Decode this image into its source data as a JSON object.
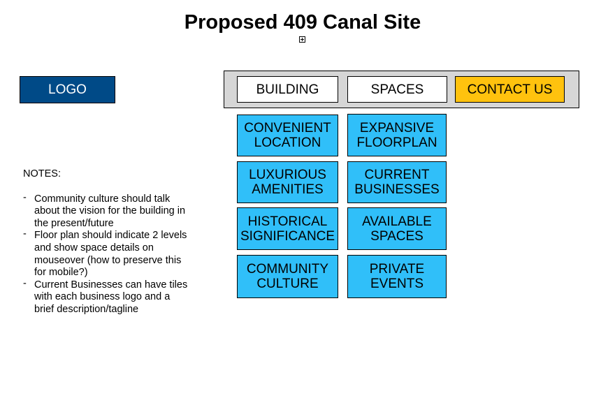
{
  "title": "Proposed 409 Canal Site",
  "logo": {
    "label": "LOGO",
    "color": "#004a87"
  },
  "nav": {
    "building": "BUILDING",
    "spaces": "SPACES",
    "contact": "CONTACT US",
    "contact_color": "#ffc20e",
    "bar_color": "#d6d6d6"
  },
  "tiles": {
    "color": "#30bff9",
    "convenient_location": "CONVENIENT LOCATION",
    "luxurious_amenities": "LUXURIOUS AMENITIES",
    "historical_significance": "HISTORICAL SIGNIFICANCE",
    "community_culture": "COMMUNITY CULTURE",
    "expansive_floorplan": "EXPANSIVE FLOORPLAN",
    "current_businesses": "CURRENT BUSINESSES",
    "available_spaces": "AVAILABLE SPACES",
    "private_events": "PRIVATE EVENTS"
  },
  "notes": {
    "heading": "NOTES:",
    "dash": "-",
    "items": [
      "Community culture should talk about the vision for the building in the present/future",
      "Floor plan should indicate 2 levels and show space details on mouseover (how to preserve this for mobile?)",
      "Current Businesses can have tiles with each business logo and a brief description/tagline"
    ]
  }
}
